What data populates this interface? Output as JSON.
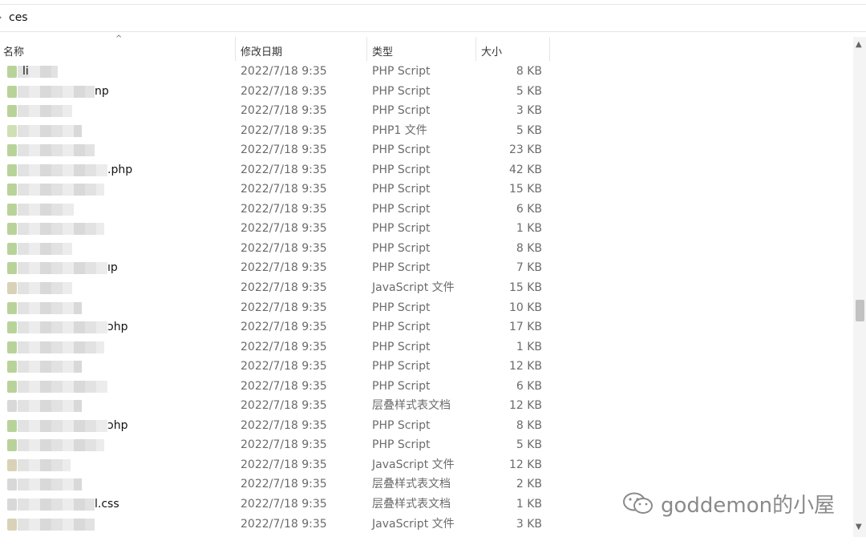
{
  "address": {
    "folder": "ces"
  },
  "columns": {
    "name": "名称",
    "date": "修改日期",
    "type": "类型",
    "size": "大小"
  },
  "rows": [
    {
      "name": "li",
      "date": "2022/7/18 9:35",
      "type": "PHP Script",
      "size": "8 KB",
      "icon": "php"
    },
    {
      "name": "np",
      "date": "2022/7/18 9:35",
      "type": "PHP Script",
      "size": "5 KB",
      "icon": "php"
    },
    {
      "name": "",
      "date": "2022/7/18 9:35",
      "type": "PHP Script",
      "size": "3 KB",
      "icon": "php"
    },
    {
      "name": "",
      "date": "2022/7/18 9:35",
      "type": "PHP1 文件",
      "size": "5 KB",
      "icon": "file"
    },
    {
      "name": "",
      "date": "2022/7/18 9:35",
      "type": "PHP Script",
      "size": "23 KB",
      "icon": "php"
    },
    {
      "name": ".php",
      "date": "2022/7/18 9:35",
      "type": "PHP Script",
      "size": "42 KB",
      "icon": "php"
    },
    {
      "name": "",
      "date": "2022/7/18 9:35",
      "type": "PHP Script",
      "size": "15 KB",
      "icon": "php"
    },
    {
      "name": "",
      "date": "2022/7/18 9:35",
      "type": "PHP Script",
      "size": "6 KB",
      "icon": "php"
    },
    {
      "name": "",
      "date": "2022/7/18 9:35",
      "type": "PHP Script",
      "size": "1 KB",
      "icon": "php"
    },
    {
      "name": "",
      "date": "2022/7/18 9:35",
      "type": "PHP Script",
      "size": "8 KB",
      "icon": "php"
    },
    {
      "name": "ıp",
      "date": "2022/7/18 9:35",
      "type": "PHP Script",
      "size": "7 KB",
      "icon": "php"
    },
    {
      "name": "",
      "date": "2022/7/18 9:35",
      "type": "JavaScript 文件",
      "size": "15 KB",
      "icon": "js"
    },
    {
      "name": "",
      "date": "2022/7/18 9:35",
      "type": "PHP Script",
      "size": "10 KB",
      "icon": "php"
    },
    {
      "name": "ɔhp",
      "date": "2022/7/18 9:35",
      "type": "PHP Script",
      "size": "17 KB",
      "icon": "php"
    },
    {
      "name": "",
      "date": "2022/7/18 9:35",
      "type": "PHP Script",
      "size": "1 KB",
      "icon": "php"
    },
    {
      "name": "",
      "date": "2022/7/18 9:35",
      "type": "PHP Script",
      "size": "12 KB",
      "icon": "php"
    },
    {
      "name": "",
      "date": "2022/7/18 9:35",
      "type": "PHP Script",
      "size": "6 KB",
      "icon": "php"
    },
    {
      "name": "",
      "date": "2022/7/18 9:35",
      "type": "层叠样式表文档",
      "size": "12 KB",
      "icon": "css"
    },
    {
      "name": "ɔhp",
      "date": "2022/7/18 9:35",
      "type": "PHP Script",
      "size": "8 KB",
      "icon": "php"
    },
    {
      "name": "",
      "date": "2022/7/18 9:35",
      "type": "PHP Script",
      "size": "5 KB",
      "icon": "php"
    },
    {
      "name": "",
      "date": "2022/7/18 9:35",
      "type": "JavaScript 文件",
      "size": "12 KB",
      "icon": "js"
    },
    {
      "name": "",
      "date": "2022/7/18 9:35",
      "type": "层叠样式表文档",
      "size": "2 KB",
      "icon": "css"
    },
    {
      "name": "l.css",
      "date": "2022/7/18 9:35",
      "type": "层叠样式表文档",
      "size": "1 KB",
      "icon": "css"
    },
    {
      "name": "",
      "date": "2022/7/18 9:35",
      "type": "JavaScript 文件",
      "size": "3 KB",
      "icon": "js"
    }
  ],
  "watermark": {
    "text": "goddemon的小屋"
  }
}
